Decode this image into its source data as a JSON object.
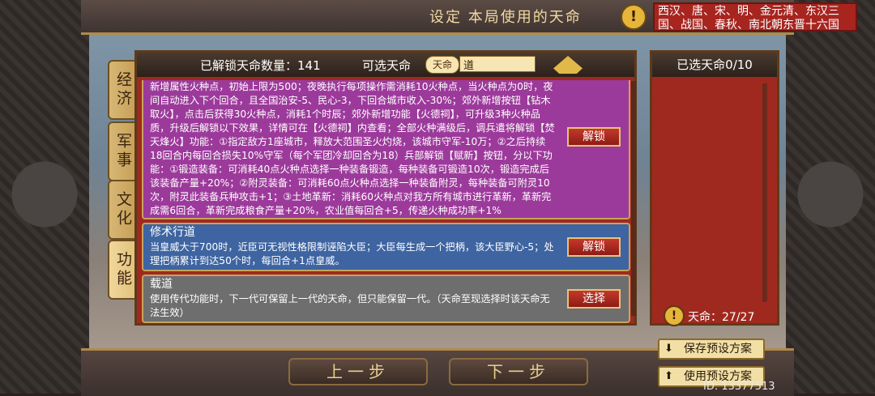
{
  "header": {
    "title": "设定 本局使用的天命",
    "warning_icon": "!",
    "dynasties": "西汉、唐、宋、明、金元清、东汉三国、战国、春秋、南北朝东晋十六国"
  },
  "tabs": [
    "经济",
    "军事",
    "文化",
    "功能"
  ],
  "main": {
    "unlocked_label": "已解锁天命数量：141",
    "available_label": "可选天命",
    "filter_pill": "天命",
    "search_value": "道",
    "cards": [
      {
        "title": "",
        "description": "新增属性火种点，初始上限为500；夜晚执行每项操作需消耗10火种点，当火种点为0时，夜间自动进入下个回合，且全国治安-5、民心-3，下回合城市收入-30%；郊外新增按钮【钻木取火】，点击后获得30火种点，消耗1个时辰；郊外新增功能【火德祠】，可升级3种火种品质，升级后解锁以下效果，详情可在【火德祠】内查看；全部火种满级后，调兵遣将解锁【焚天烽火】功能：①指定敌方1座城市，释放大范围圣火灼烧，该城市守军-10万；②之后持续18回合内每回合损失10%守军（每个军团冷却回合为18）兵部解锁【赋新】按钮，分以下功能：①锻造装备：可消耗40点火种点选择一种装备锻造，每种装备可锻造10次，锻造完成后该装备产量+20%；②附灵装备：可消耗60点火种点选择一种装备附灵，每种装备可附灵10次，附灵此装备兵种攻击+1；③土地革新：消耗60火种点对我方所有城市进行革新，革新完成需6回合，革新完成粮食产量+20%，农业值每回合+5，传递火种成功率+1%",
        "button": "解锁"
      },
      {
        "title": "修术行道",
        "description": "当皇威大于700时，近臣可无视性格限制诬陷大臣；大臣每生成一个把柄，该大臣野心-5；处理把柄累计到达50个时，每回合+1点皇威。",
        "button": "解锁"
      },
      {
        "title": "载道",
        "description": "使用传代功能时，下一代可保留上一代的天命，但只能保留一代。（天命至现选择时该天命无法生效）",
        "button": "选择"
      }
    ]
  },
  "right_panel": {
    "title": "已选天命0/10",
    "warning_icon": "!",
    "mandate_count": "天命：27/27"
  },
  "bottom": {
    "prev": "上一步",
    "next": "下一步",
    "save_preset": "保存预设方案",
    "use_preset": "使用预设方案",
    "id": "ID: 13377513"
  }
}
